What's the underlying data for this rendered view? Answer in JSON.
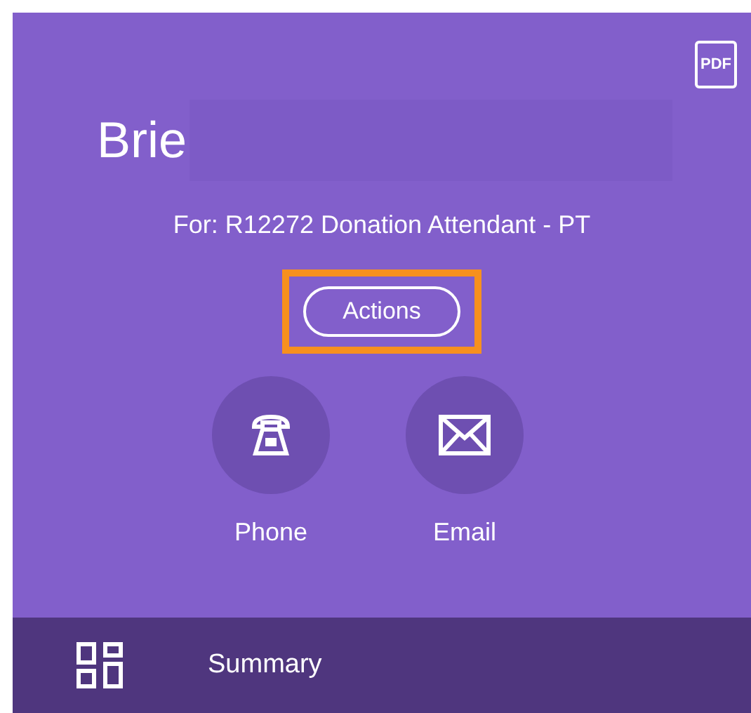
{
  "header": {
    "pdf_label": "PDF",
    "name": "Brie",
    "subtitle": "For: R12272 Donation Attendant - PT"
  },
  "actions_button": {
    "label": "Actions",
    "highlighted": true
  },
  "contact_buttons": [
    {
      "kind": "phone",
      "label": "Phone"
    },
    {
      "kind": "email",
      "label": "Email"
    }
  ],
  "bottom_bar": {
    "label": "Summary"
  }
}
